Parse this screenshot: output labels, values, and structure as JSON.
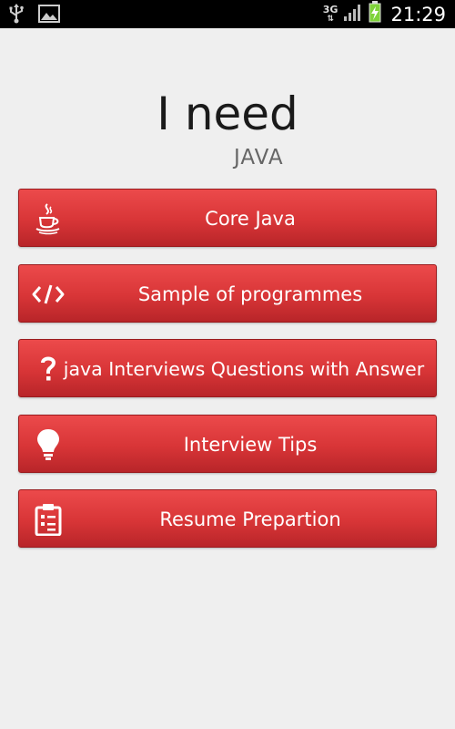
{
  "status_bar": {
    "network": "3G",
    "time": "21:29"
  },
  "header": {
    "title": "I need",
    "subtitle": "JAVA"
  },
  "menu": [
    {
      "label": "Core Java",
      "icon": "java-cup-icon"
    },
    {
      "label": "Sample of programmes",
      "icon": "code-brackets-icon"
    },
    {
      "label": "java Interviews Questions with Answer",
      "icon": "question-mark-icon"
    },
    {
      "label": "Interview Tips",
      "icon": "lightbulb-icon"
    },
    {
      "label": "Resume Prepartion",
      "icon": "clipboard-icon"
    }
  ],
  "colors": {
    "button_top": "#ec4a4b",
    "button_bottom": "#b82529",
    "background": "#efefef",
    "status_bar": "#000000",
    "battery_charge": "#7fd33a"
  }
}
